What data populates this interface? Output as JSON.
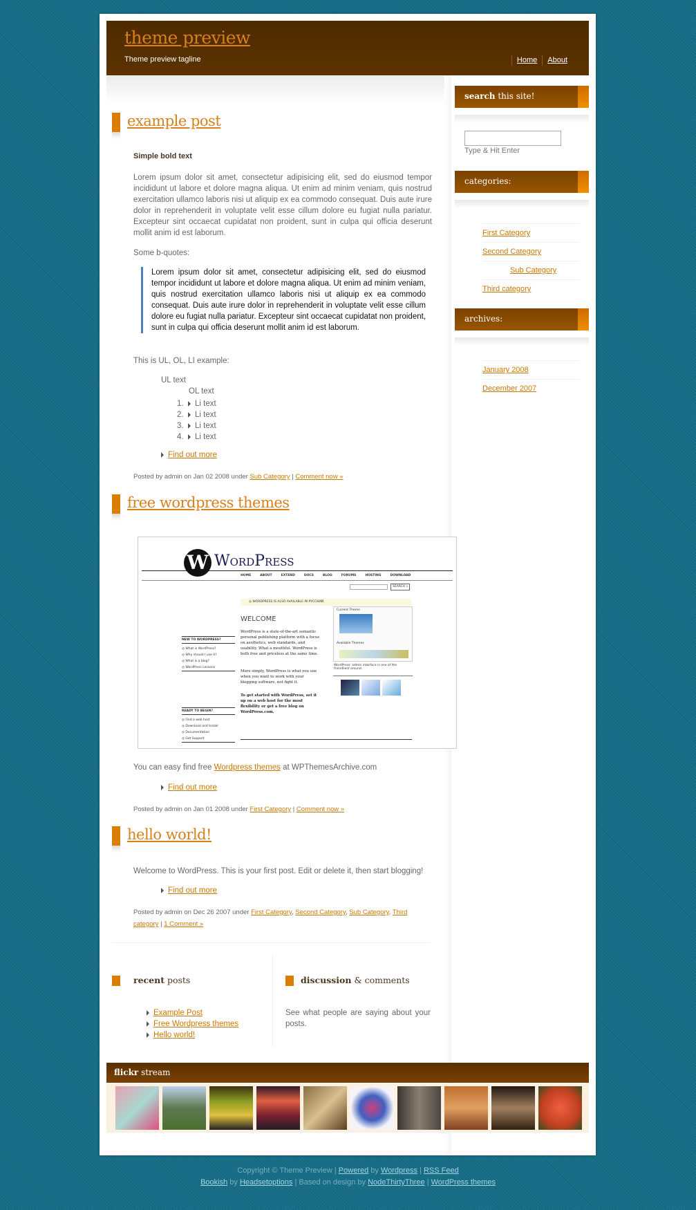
{
  "header": {
    "title": "theme preview",
    "tagline": "Theme preview tagline",
    "nav": [
      "Home",
      "About"
    ]
  },
  "posts": [
    {
      "title": "example post",
      "bold": "Simple bold text",
      "para": "Lorem ipsum dolor sit amet, consectetur adipisicing elit, sed do eiusmod tempor incididunt ut labore et dolore magna aliqua. Ut enim ad minim veniam, quis nostrud exercitation ullamco laboris nisi ut aliquip ex ea commodo consequat. Duis aute irure dolor in reprehenderit in voluptate velit esse cillum dolore eu fugiat nulla pariatur. Excepteur sint occaecat cupidatat non proident, sunt in culpa qui officia deserunt mollit anim id est laborum.",
      "bq_label": "Some b-quotes:",
      "blockquote": "Lorem ipsum dolor sit amet, consectetur adipisicing elit, sed do eiusmod tempor incididunt ut labore et dolore magna aliqua. Ut enim ad minim veniam, quis nostrud exercitation ullamco laboris nisi ut aliquip ex ea commodo consequat. Duis aute irure dolor in reprehenderit in voluptate velit esse cillum dolore eu fugiat nulla pariatur. Excepteur sint occaecat cupidatat non proident, sunt in culpa qui officia deserunt mollit anim id est laborum.",
      "list_label": "This is UL, OL, LI example:",
      "ul_text": "UL text",
      "ol_text": "OL text",
      "li": [
        "1.",
        "2.",
        "3.",
        "4."
      ],
      "li_text": "Li text",
      "more": "Find out more",
      "meta_prefix": "Posted by admin on Jan 02 2008 under",
      "cats": [
        "Sub Category"
      ],
      "sep": "|",
      "comment": "Comment now »"
    },
    {
      "title": "free wordpress themes",
      "text_before": "You can easy find free",
      "link": "Wordpress themes",
      "text_after": "at WPThemesArchive.com",
      "more": "Find out more",
      "meta_prefix": "Posted by admin on Jan 01 2008 under",
      "cats": [
        "First Category"
      ],
      "comment": "Comment now »"
    },
    {
      "title": "hello world!",
      "text": "Welcome to WordPress. This is your first post. Edit or delete it, then start blogging!",
      "more": "Find out more",
      "meta_prefix": "Posted by admin on Dec 26 2007 under",
      "cats": [
        "First Category",
        "Second Category",
        "Sub Category",
        "Third category"
      ],
      "comment": "1 Comment »"
    }
  ],
  "wp_image": {
    "logo": "WordPress",
    "nav": [
      "HOME",
      "ABOUT",
      "EXTEND",
      "DOCS",
      "BLOG",
      "FORUMS",
      "HOSTING",
      "DOWNLOAD"
    ],
    "search": "SEARCH »",
    "notice": "◎ WORDPRESS IS ALSO AVAILABLE IN РУССКИЙ.",
    "welcome": "WELCOME",
    "p1": "WordPress is a state-of-the-art semantic personal publishing platform with a focus on aesthetics, web standards, and usability. What a mouthful. WordPress is both free and priceless at the same time.",
    "p2": "More simply, WordPress is what you use when you want to work with your blogging software, not fight it.",
    "p3": "To get started with WordPress, set it up on a web host for the most flexibility or get a free blog on WordPress.com.",
    "new_head": "NEW TO WORDPRESS?",
    "new_items": [
      "◎ What is WordPress?",
      "◎ Why should I use it?",
      "◎ What is a blog?",
      "◎ WordPress Lessons"
    ],
    "ready_head": "READY TO BEGIN?",
    "ready_items": [
      "◎ Find a web host",
      "◎ Download and Install",
      "◎ Documentation",
      "◎ Get Support"
    ],
    "current_theme": "Current Theme",
    "available": "Available Themes",
    "caption": "WordPress' admin interface is one of the friendliest around."
  },
  "sidebar": {
    "search_bold": "search",
    "search_rest": "this site!",
    "search_hint": "Type & Hit Enter",
    "categories_title": "categories:",
    "categories": [
      "First Category",
      "Second Category",
      "Sub Category",
      "Third category"
    ],
    "archives_title": "archives:",
    "archives": [
      "January 2008",
      "December 2007"
    ]
  },
  "bottom": {
    "recent_bold": "recent",
    "recent_rest": "posts",
    "recent": [
      "Example Post",
      "Free Wordpress themes",
      "Hello world!"
    ],
    "disc_bold": "discussion",
    "disc_rest": "& comments",
    "disc_text": "See what people are saying about your posts."
  },
  "flickr": {
    "bold": "flickr",
    "rest": "stream",
    "count": 10
  },
  "footer": {
    "copyright": "Copyright © Theme Preview |",
    "powered": "Powered",
    "by": "by",
    "wordpress": "Wordpress",
    "sep": "|",
    "rss": "RSS Feed",
    "bookish": "Bookish",
    "headset": "Headsetoptions",
    "based": "| Based on design by",
    "node": "NodeThirtyThree",
    "wpthemes": "WordPress themes"
  },
  "colors": {
    "accent": "#db7d00",
    "link": "#c87800",
    "header": "#4e2a00",
    "background": "#156a82",
    "quote_bar": "#4a7fc0"
  }
}
